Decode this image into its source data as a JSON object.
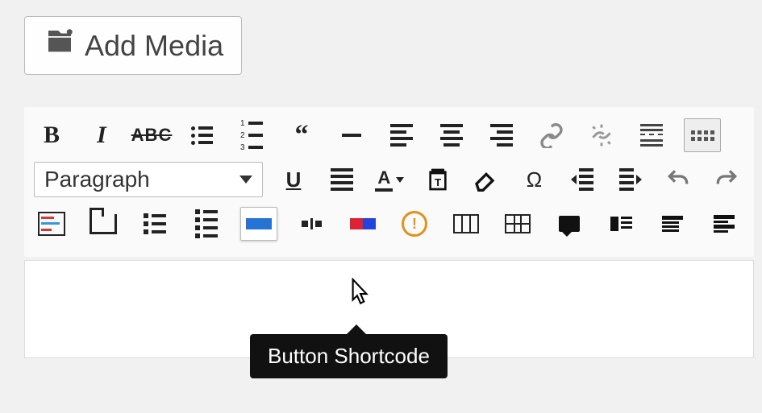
{
  "add_media_label": "Add Media",
  "format_dropdown": {
    "selected": "Paragraph"
  },
  "tooltip": {
    "text": "Button Shortcode"
  },
  "row1": {
    "bold": "B",
    "italic": "I",
    "strike": "ABC",
    "underline": "U",
    "textcolor": "A"
  },
  "icons": {
    "special_char": "Ω",
    "warn": "!"
  }
}
